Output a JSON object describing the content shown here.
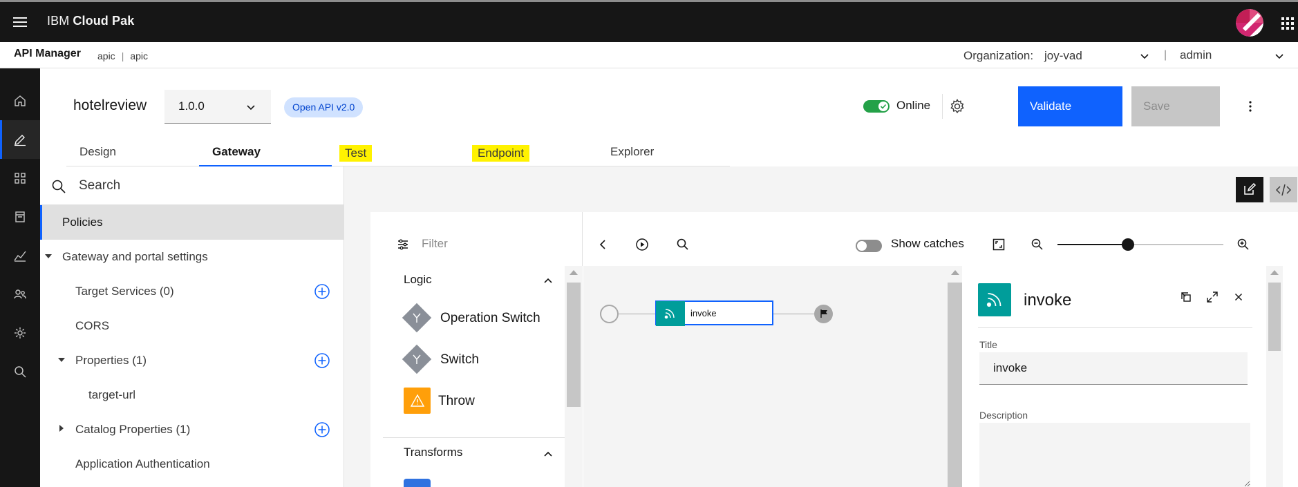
{
  "topbar": {
    "brand_prefix": "IBM",
    "brand_name": "Cloud Pak"
  },
  "subbar": {
    "title": "API Manager",
    "crumb_1": "apic",
    "crumb_sep": "|",
    "crumb_2": "apic",
    "org_label": "Organization:",
    "org_value": "joy-vad",
    "divider": "|",
    "user_value": "admin"
  },
  "rail": {
    "items": [
      "home-icon",
      "edit-icon",
      "apps-icon",
      "catalog-icon",
      "analytics-icon",
      "members-icon",
      "settings-icon",
      "search-icon"
    ],
    "active_index": 1
  },
  "api": {
    "name": "hotelreview",
    "version": "1.0.0",
    "spec_tag": "Open API v2.0",
    "online_label": "Online",
    "online": true,
    "validate_label": "Validate",
    "save_label": "Save"
  },
  "tabs": [
    {
      "label": "Design",
      "active": false,
      "highlighted": false
    },
    {
      "label": "Gateway",
      "active": true,
      "highlighted": false
    },
    {
      "label": "Test",
      "active": false,
      "highlighted": true
    },
    {
      "label": "Endpoint",
      "active": false,
      "highlighted": true
    },
    {
      "label": "Explorer",
      "active": false,
      "highlighted": false
    }
  ],
  "nav": {
    "search_placeholder": "Search",
    "items": [
      {
        "label": "Policies",
        "active": true
      },
      {
        "label": "Gateway and portal settings",
        "expanded": true
      },
      {
        "label": "Target Services (0)",
        "addable": true
      },
      {
        "label": "CORS"
      },
      {
        "label": "Properties (1)",
        "expanded": true,
        "addable": true
      },
      {
        "label": "target-url"
      },
      {
        "label": "Catalog Properties (1)",
        "expanded": false,
        "addable": true
      },
      {
        "label": "Application Authentication"
      }
    ]
  },
  "palette": {
    "filter_placeholder": "Filter",
    "logic_label": "Logic",
    "logic_items": [
      "Operation Switch",
      "Switch",
      "Throw"
    ],
    "transforms_label": "Transforms"
  },
  "flow": {
    "show_catches_label": "Show catches",
    "show_catches": false,
    "zoom_level": 0.43,
    "node_name": "invoke"
  },
  "props": {
    "title": "invoke",
    "title_label": "Title",
    "title_value": "invoke",
    "description_label": "Description",
    "description_value": ""
  },
  "colors": {
    "primary": "#0f62fe",
    "online": "#24a148",
    "invoke": "#009d9a",
    "throw": "#ff9f0a",
    "highlight": "#fff200"
  }
}
